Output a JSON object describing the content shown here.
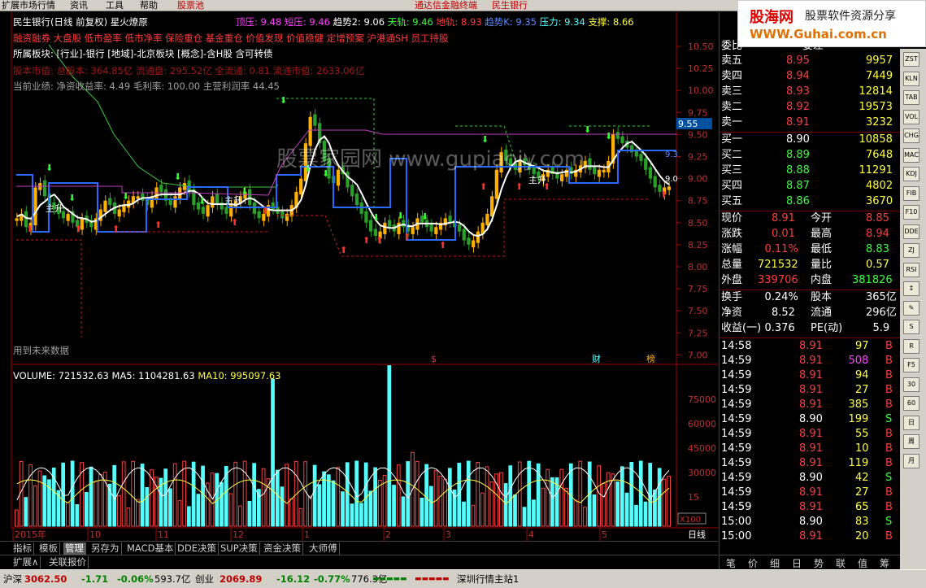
{
  "menu": {
    "items": [
      "扩展市场行情",
      "资讯",
      "工具",
      "帮助",
      "股票池"
    ],
    "center": "通达信金融终端",
    "stock_name_menu": "民生银行"
  },
  "header": {
    "title": "民生银行(日线 前复权) 星火燎原",
    "ind": [
      {
        "t": "顶压: 9.48",
        "c": "#ff40ff"
      },
      {
        "t": "短压: 9.46",
        "c": "#ff40ff"
      },
      {
        "t": "趋势2: 9.06",
        "c": "#ffffff"
      },
      {
        "t": "天轨: 9.46",
        "c": "#3cff3c"
      },
      {
        "t": "地轨: 8.93",
        "c": "#ff3c3c"
      },
      {
        "t": "趋势K: 9.35",
        "c": "#5a8cff"
      },
      {
        "t": "压力: 9.34",
        "c": "#5ff"
      },
      {
        "t": "支撑: 8.66",
        "c": "#ffff40"
      }
    ]
  },
  "tags_line": "融资融券 大盘股 低市盈率 低市净率 保险重仓 基金重仓 价值发现 价值稳健 定增预案 沪港通SH 员工持股",
  "sector_line": "所属板块: [行业]-银行 [地域]-北京板块 [概念]-含H股 含可转债",
  "capital_line": "股本市值: 总股本: 364.85亿 流通盘: 295.52亿 全流通: 0.81 流通市值: 2633.06亿",
  "perf_line": "当前业绩: 净资收益率: 4.49 毛利率: 100.00 主营利润率 44.45",
  "future_data_note": "用到未来数据",
  "watermark": "股票家园网 www.gupiaojy.com",
  "markers": {
    "dollar": "$",
    "cai": "财",
    "bang": "榜",
    "zhu": "主升"
  },
  "price_axis": {
    "labels": [
      "10.50",
      "10.25",
      "10.00",
      "9.75",
      "9.50",
      "9.25",
      "9.00",
      "8.75",
      "8.50",
      "8.25",
      "8.00",
      "7.75",
      "7.50",
      "7.25",
      "7.00"
    ],
    "current": "9.55",
    "lbl1": "9.3",
    "lbl2": "9.0"
  },
  "volume": {
    "header_vol": "VOLUME: 721532.63",
    "header_ma5": "MA5: 1104281.63",
    "header_ma10": "MA10: 995097.63",
    "axis": [
      "75000",
      "60000",
      "45000",
      "30000",
      "15"
    ],
    "unit": "X100"
  },
  "time_axis": {
    "labels": [
      "2015年",
      "10",
      "11",
      "12",
      "1",
      "2",
      "3",
      "4",
      "5"
    ],
    "period": "日线"
  },
  "tabs": [
    "指标",
    "模板",
    "管理",
    "另存为",
    "MACD基本",
    "DDE决策",
    "SUP决策",
    "资金决策",
    "大师傅"
  ],
  "tabs2": [
    "扩展∧",
    "关联报价"
  ],
  "quote": {
    "top_label": "委比",
    "top_label2": "委差",
    "asks": [
      {
        "n": "卖五",
        "p": "8.95",
        "v": "9957"
      },
      {
        "n": "卖四",
        "p": "8.94",
        "v": "7449"
      },
      {
        "n": "卖三",
        "p": "8.93",
        "v": "12814"
      },
      {
        "n": "卖二",
        "p": "8.92",
        "v": "19573"
      },
      {
        "n": "卖一",
        "p": "8.91",
        "v": "3232"
      }
    ],
    "bids": [
      {
        "n": "买一",
        "p": "8.90",
        "v": "10858"
      },
      {
        "n": "买二",
        "p": "8.89",
        "v": "7648"
      },
      {
        "n": "买三",
        "p": "8.88",
        "v": "11291"
      },
      {
        "n": "买四",
        "p": "8.87",
        "v": "4802"
      },
      {
        "n": "买五",
        "p": "8.86",
        "v": "3670"
      }
    ],
    "stats": [
      {
        "a": "现价",
        "av": "8.91",
        "b": "今开",
        "bv": "8.85"
      },
      {
        "a": "涨跌",
        "av": "0.01",
        "b": "最高",
        "bv": "8.94"
      },
      {
        "a": "涨幅",
        "av": "0.11%",
        "b": "最低",
        "bv": "8.83"
      },
      {
        "a": "总量",
        "av": "721532",
        "b": "量比",
        "bv": "0.57"
      },
      {
        "a": "外盘",
        "av": "339706",
        "b": "内盘",
        "bv": "381826"
      }
    ],
    "stats2": [
      {
        "a": "换手",
        "av": "0.24%",
        "b": "股本",
        "bv": "365亿"
      },
      {
        "a": "净资",
        "av": "8.52",
        "b": "流通",
        "bv": "296亿"
      },
      {
        "a": "收益(一)",
        "av": "0.376",
        "b": "PE(动)",
        "bv": "5.9"
      }
    ],
    "ticks": [
      [
        "14:58",
        "8.91",
        "97",
        "B"
      ],
      [
        "14:59",
        "8.91",
        "508",
        "B"
      ],
      [
        "14:59",
        "8.91",
        "94",
        "B"
      ],
      [
        "14:59",
        "8.91",
        "27",
        "B"
      ],
      [
        "14:59",
        "8.91",
        "385",
        "B"
      ],
      [
        "14:59",
        "8.90",
        "199",
        "S"
      ],
      [
        "14:59",
        "8.91",
        "55",
        "B"
      ],
      [
        "14:59",
        "8.91",
        "10",
        "B"
      ],
      [
        "14:59",
        "8.91",
        "119",
        "B"
      ],
      [
        "14:59",
        "8.90",
        "42",
        "S"
      ],
      [
        "14:59",
        "8.91",
        "27",
        "B"
      ],
      [
        "14:59",
        "8.91",
        "65",
        "B"
      ],
      [
        "15:00",
        "8.90",
        "83",
        "S"
      ],
      [
        "15:00",
        "8.91",
        "20",
        "B"
      ]
    ],
    "bottom_tabs": [
      "笔",
      "价",
      "细",
      "日",
      "势",
      "联",
      "值",
      "筹"
    ]
  },
  "logo": {
    "l1": "股海网",
    "l2": "股票软件资源分享",
    "l3": "WWW.Guhai.com.cn"
  },
  "status": {
    "sh_name": "沪深",
    "sh_val": "3062.50",
    "sh_chg": "-1.71",
    "sh_pct": "-0.06%",
    "sh_amt": "593.7亿",
    "cy_name": "创业",
    "cy_val": "2069.89",
    "cy_chg": "-16.12",
    "cy_pct": "-0.77%",
    "cy_amt": "776.3亿",
    "station": "深圳行情主站1"
  },
  "tool_icons": [
    "ZST",
    "KLN",
    "TAB",
    "VOL",
    "CHG",
    "MAC",
    "KDJ",
    "FIB",
    "F10",
    "DDE",
    "ZJ",
    "RSI",
    "↕",
    "✎",
    "S",
    "R",
    "F5",
    "30",
    "60",
    "日",
    "周",
    "月"
  ]
}
